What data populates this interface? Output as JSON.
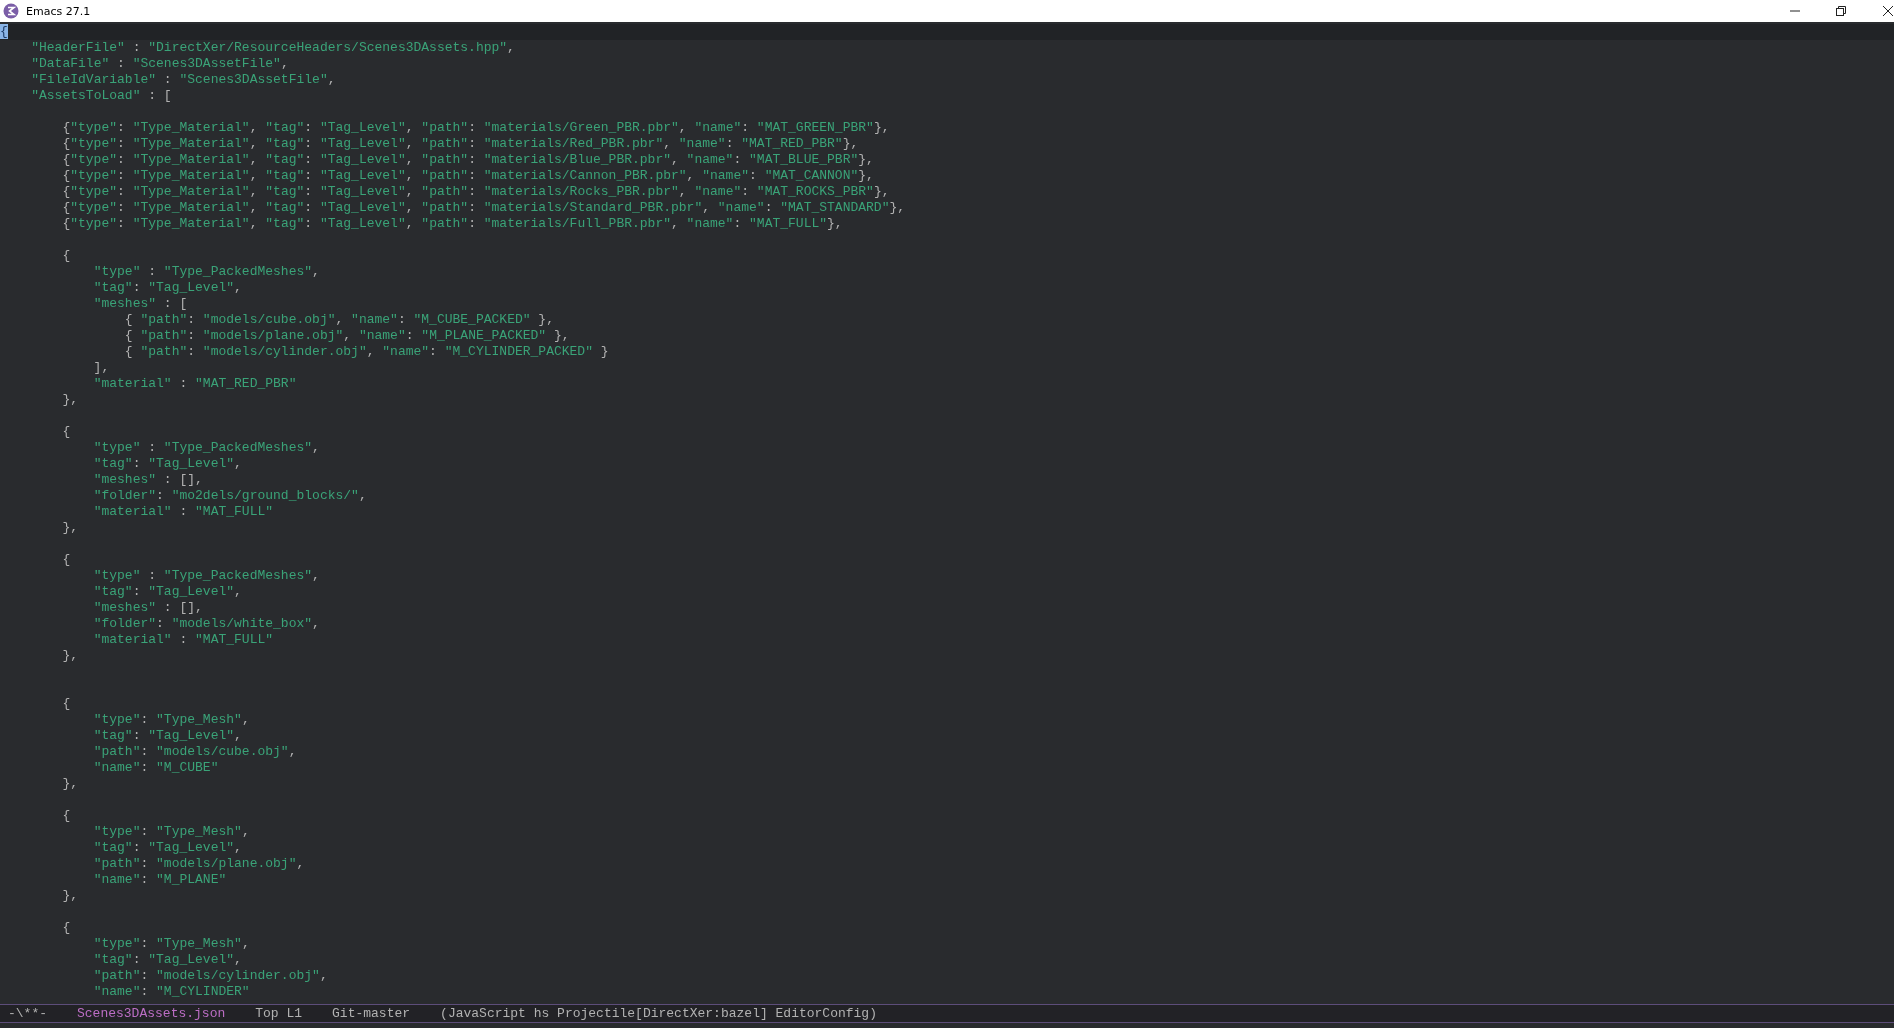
{
  "window": {
    "title": "Emacs 27.1"
  },
  "buffer": {
    "lines": [
      {
        "kind": "code",
        "text": "{",
        "current": true
      },
      {
        "kind": "code",
        "text": "    \"HeaderFile\" : \"DirectXer/ResourceHeaders/Scenes3DAssets.hpp\",",
        "current": false
      },
      {
        "kind": "code",
        "text": "    \"DataFile\" : \"Scenes3DAssetFile\",",
        "current": false
      },
      {
        "kind": "code",
        "text": "    \"FileIdVariable\" : \"Scenes3DAssetFile\",",
        "current": false
      },
      {
        "kind": "code",
        "text": "    \"AssetsToLoad\" : [",
        "current": false
      },
      {
        "kind": "blank"
      },
      {
        "kind": "code",
        "text": "        {\"type\": \"Type_Material\", \"tag\": \"Tag_Level\", \"path\": \"materials/Green_PBR.pbr\", \"name\": \"MAT_GREEN_PBR\"},",
        "current": false
      },
      {
        "kind": "code",
        "text": "        {\"type\": \"Type_Material\", \"tag\": \"Tag_Level\", \"path\": \"materials/Red_PBR.pbr\", \"name\": \"MAT_RED_PBR\"},",
        "current": false
      },
      {
        "kind": "code",
        "text": "        {\"type\": \"Type_Material\", \"tag\": \"Tag_Level\", \"path\": \"materials/Blue_PBR.pbr\", \"name\": \"MAT_BLUE_PBR\"},",
        "current": false
      },
      {
        "kind": "code",
        "text": "        {\"type\": \"Type_Material\", \"tag\": \"Tag_Level\", \"path\": \"materials/Cannon_PBR.pbr\", \"name\": \"MAT_CANNON\"},",
        "current": false
      },
      {
        "kind": "code",
        "text": "        {\"type\": \"Type_Material\", \"tag\": \"Tag_Level\", \"path\": \"materials/Rocks_PBR.pbr\", \"name\": \"MAT_ROCKS_PBR\"},",
        "current": false
      },
      {
        "kind": "code",
        "text": "        {\"type\": \"Type_Material\", \"tag\": \"Tag_Level\", \"path\": \"materials/Standard_PBR.pbr\", \"name\": \"MAT_STANDARD\"},",
        "current": false
      },
      {
        "kind": "code",
        "text": "        {\"type\": \"Type_Material\", \"tag\": \"Tag_Level\", \"path\": \"materials/Full_PBR.pbr\", \"name\": \"MAT_FULL\"},",
        "current": false
      },
      {
        "kind": "blank"
      },
      {
        "kind": "code",
        "text": "        {",
        "current": false
      },
      {
        "kind": "code",
        "text": "            \"type\" : \"Type_PackedMeshes\",",
        "current": false
      },
      {
        "kind": "code",
        "text": "            \"tag\": \"Tag_Level\",",
        "current": false
      },
      {
        "kind": "code",
        "text": "            \"meshes\" : [",
        "current": false
      },
      {
        "kind": "code",
        "text": "                { \"path\": \"models/cube.obj\", \"name\": \"M_CUBE_PACKED\" },",
        "current": false
      },
      {
        "kind": "code",
        "text": "                { \"path\": \"models/plane.obj\", \"name\": \"M_PLANE_PACKED\" },",
        "current": false
      },
      {
        "kind": "code",
        "text": "                { \"path\": \"models/cylinder.obj\", \"name\": \"M_CYLINDER_PACKED\" }",
        "current": false
      },
      {
        "kind": "code",
        "text": "            ],",
        "current": false
      },
      {
        "kind": "code",
        "text": "            \"material\" : \"MAT_RED_PBR\"",
        "current": false
      },
      {
        "kind": "code",
        "text": "        },",
        "current": false
      },
      {
        "kind": "blank"
      },
      {
        "kind": "code",
        "text": "        {",
        "current": false
      },
      {
        "kind": "code",
        "text": "            \"type\" : \"Type_PackedMeshes\",",
        "current": false
      },
      {
        "kind": "code",
        "text": "            \"tag\": \"Tag_Level\",",
        "current": false
      },
      {
        "kind": "code",
        "text": "            \"meshes\" : [],",
        "current": false
      },
      {
        "kind": "code",
        "text": "            \"folder\": \"mo2dels/ground_blocks/\",",
        "current": false
      },
      {
        "kind": "code",
        "text": "            \"material\" : \"MAT_FULL\"",
        "current": false
      },
      {
        "kind": "code",
        "text": "        },",
        "current": false
      },
      {
        "kind": "blank"
      },
      {
        "kind": "code",
        "text": "        {",
        "current": false
      },
      {
        "kind": "code",
        "text": "            \"type\" : \"Type_PackedMeshes\",",
        "current": false
      },
      {
        "kind": "code",
        "text": "            \"tag\": \"Tag_Level\",",
        "current": false
      },
      {
        "kind": "code",
        "text": "            \"meshes\" : [],",
        "current": false
      },
      {
        "kind": "code",
        "text": "            \"folder\": \"models/white_box\",",
        "current": false
      },
      {
        "kind": "code",
        "text": "            \"material\" : \"MAT_FULL\"",
        "current": false
      },
      {
        "kind": "code",
        "text": "        },",
        "current": false
      },
      {
        "kind": "blank"
      },
      {
        "kind": "blank"
      },
      {
        "kind": "code",
        "text": "        {",
        "current": false
      },
      {
        "kind": "code",
        "text": "            \"type\": \"Type_Mesh\",",
        "current": false
      },
      {
        "kind": "code",
        "text": "            \"tag\": \"Tag_Level\",",
        "current": false
      },
      {
        "kind": "code",
        "text": "            \"path\": \"models/cube.obj\",",
        "current": false
      },
      {
        "kind": "code",
        "text": "            \"name\": \"M_CUBE\"",
        "current": false
      },
      {
        "kind": "code",
        "text": "        },",
        "current": false
      },
      {
        "kind": "blank"
      },
      {
        "kind": "code",
        "text": "        {",
        "current": false
      },
      {
        "kind": "code",
        "text": "            \"type\": \"Type_Mesh\",",
        "current": false
      },
      {
        "kind": "code",
        "text": "            \"tag\": \"Tag_Level\",",
        "current": false
      },
      {
        "kind": "code",
        "text": "            \"path\": \"models/plane.obj\",",
        "current": false
      },
      {
        "kind": "code",
        "text": "            \"name\": \"M_PLANE\"",
        "current": false
      },
      {
        "kind": "code",
        "text": "        },",
        "current": false
      },
      {
        "kind": "blank"
      },
      {
        "kind": "code",
        "text": "        {",
        "current": false
      },
      {
        "kind": "code",
        "text": "            \"type\": \"Type_Mesh\",",
        "current": false
      },
      {
        "kind": "code",
        "text": "            \"tag\": \"Tag_Level\",",
        "current": false
      },
      {
        "kind": "code",
        "text": "            \"path\": \"models/cylinder.obj\",",
        "current": false
      },
      {
        "kind": "code",
        "text": "            \"name\": \"M_CYLINDER\"",
        "current": false
      }
    ]
  },
  "mode_line": {
    "status": "-\\**-",
    "buffer_name": "Scenes3DAssets.json",
    "position": "Top L1",
    "vc": "Git-master",
    "modes": "(JavaScript hs Projectile[DirectXer:bazel] EditorConfig)"
  }
}
